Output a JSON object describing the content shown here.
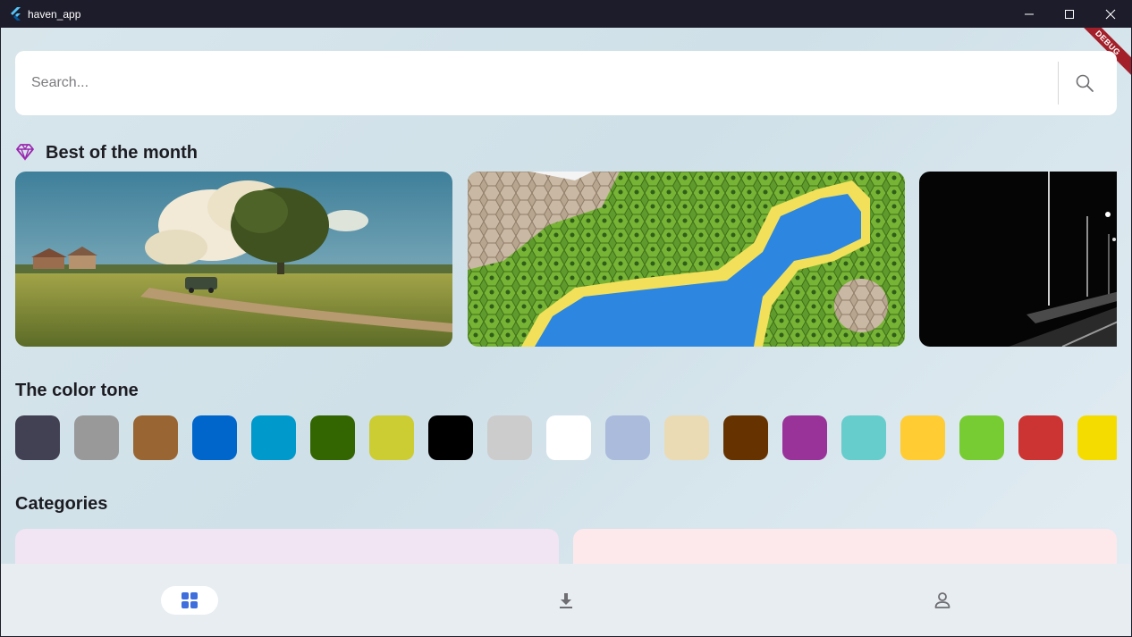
{
  "window": {
    "title": "haven_app"
  },
  "debug_banner": "DEBUG",
  "search": {
    "placeholder": "Search..."
  },
  "sections": {
    "best_of_month": "Best of the month",
    "color_tone": "The color tone",
    "categories": "Categories"
  },
  "best_of_month_items": [
    {
      "name": "countryside-landscape-wallpaper"
    },
    {
      "name": "hexagon-island-wallpaper"
    },
    {
      "name": "night-highway-wallpaper"
    }
  ],
  "color_tones": [
    "#424153",
    "#999999",
    "#996633",
    "#0066cc",
    "#0099cc",
    "#336600",
    "#cccc33",
    "#000000",
    "#cccccc",
    "#ffffff",
    "#abbbdc",
    "#eadbb5",
    "#663300",
    "#993399",
    "#66cccc",
    "#ffcc33",
    "#77cc33",
    "#cc3333",
    "#f5dc00"
  ],
  "nav": {
    "items": [
      {
        "icon": "grid-icon",
        "active": true
      },
      {
        "icon": "download-icon",
        "active": false
      },
      {
        "icon": "person-icon",
        "active": false
      }
    ]
  },
  "colors": {
    "accent": "#3f6fdc",
    "gem": "#9b27b0",
    "titlebar": "#1d1c2a",
    "nav_background": "#e7edf0"
  }
}
